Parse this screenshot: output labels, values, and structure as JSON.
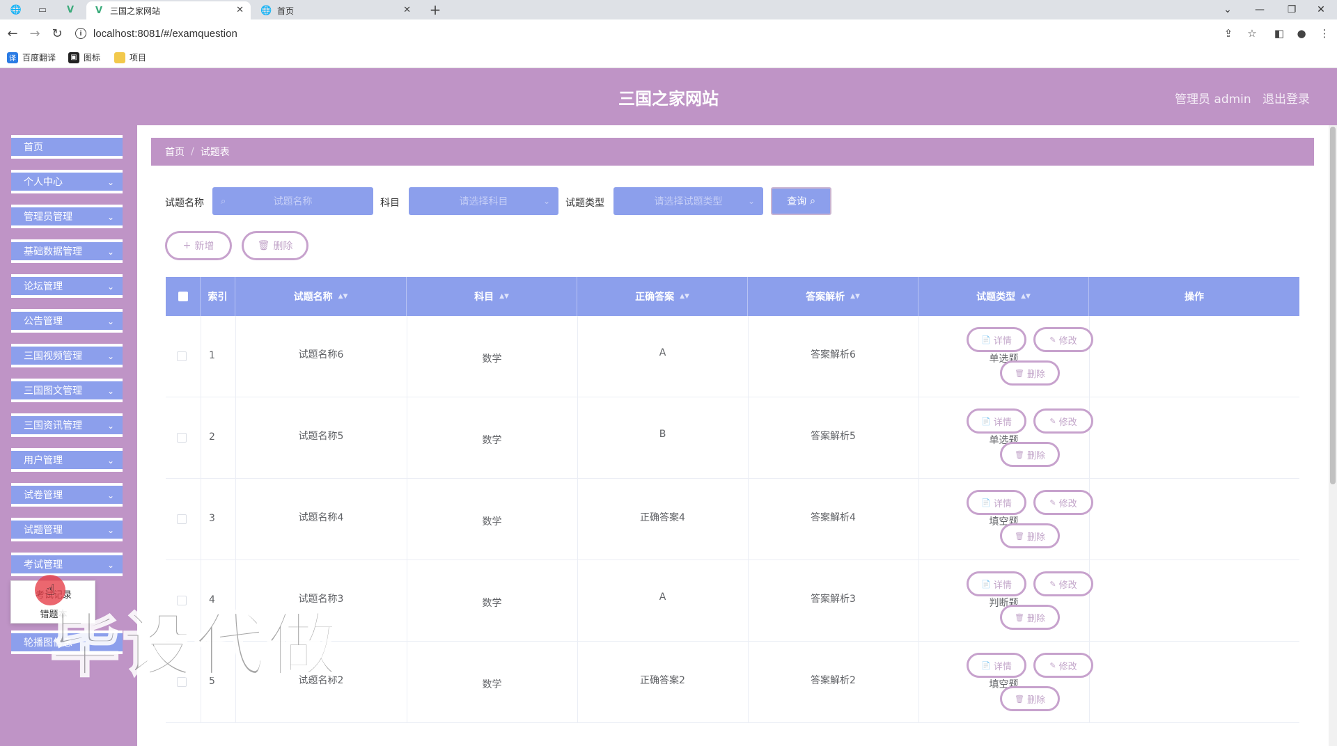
{
  "browser": {
    "tabs": [
      {
        "title": "三国之家网站",
        "active": true
      },
      {
        "title": "首页",
        "active": false
      }
    ],
    "url": "localhost:8081/#/examquestion",
    "bookmarks": [
      "百度翻译",
      "图标",
      "项目"
    ]
  },
  "header": {
    "site_title": "三国之家网站",
    "admin_label": "管理员 admin",
    "logout_label": "退出登录"
  },
  "sidebar": {
    "items": [
      {
        "label": "首页"
      },
      {
        "label": "个人中心"
      },
      {
        "label": "管理员管理"
      },
      {
        "label": "基础数据管理"
      },
      {
        "label": "论坛管理"
      },
      {
        "label": "公告管理"
      },
      {
        "label": "三国视频管理"
      },
      {
        "label": "三国图文管理"
      },
      {
        "label": "三国资讯管理"
      },
      {
        "label": "用户管理"
      },
      {
        "label": "试卷管理"
      },
      {
        "label": "试题管理"
      },
      {
        "label": "考试管理"
      },
      {
        "label": "轮播图信息"
      }
    ],
    "submenu": [
      "考试记录",
      "错题本"
    ]
  },
  "breadcrumb": {
    "home": "首页",
    "current": "试题表"
  },
  "filters": {
    "name_label": "试题名称",
    "name_placeholder": "试题名称",
    "subject_label": "科目",
    "subject_placeholder": "请选择科目",
    "type_label": "试题类型",
    "type_placeholder": "请选择试题类型",
    "query_label": "查询"
  },
  "actions": {
    "add_label": "新增",
    "delete_label": "删除"
  },
  "table": {
    "columns": [
      "索引",
      "试题名称",
      "科目",
      "正确答案",
      "答案解析",
      "试题类型",
      "操作"
    ],
    "rows": [
      {
        "index": "1",
        "name": "试题名称6",
        "subject": "数学",
        "answer": "A",
        "analysis": "答案解析6",
        "type": "单选题"
      },
      {
        "index": "2",
        "name": "试题名称5",
        "subject": "数学",
        "answer": "B",
        "analysis": "答案解析5",
        "type": "单选题"
      },
      {
        "index": "3",
        "name": "试题名称4",
        "subject": "数学",
        "answer": "正确答案4",
        "analysis": "答案解析4",
        "type": "填空题"
      },
      {
        "index": "4",
        "name": "试题名称3",
        "subject": "数学",
        "answer": "A",
        "analysis": "答案解析3",
        "type": "判断题"
      },
      {
        "index": "5",
        "name": "试题名称2",
        "subject": "数学",
        "answer": "正确答案2",
        "analysis": "答案解析2",
        "type": "填空题"
      }
    ],
    "row_actions": {
      "detail": "详情",
      "edit": "修改",
      "delete": "删除"
    }
  },
  "watermark": "毕设代做",
  "colors": {
    "header": "#bf94c6",
    "accent": "#8c9fec",
    "button_border": "#c7a2cd"
  }
}
